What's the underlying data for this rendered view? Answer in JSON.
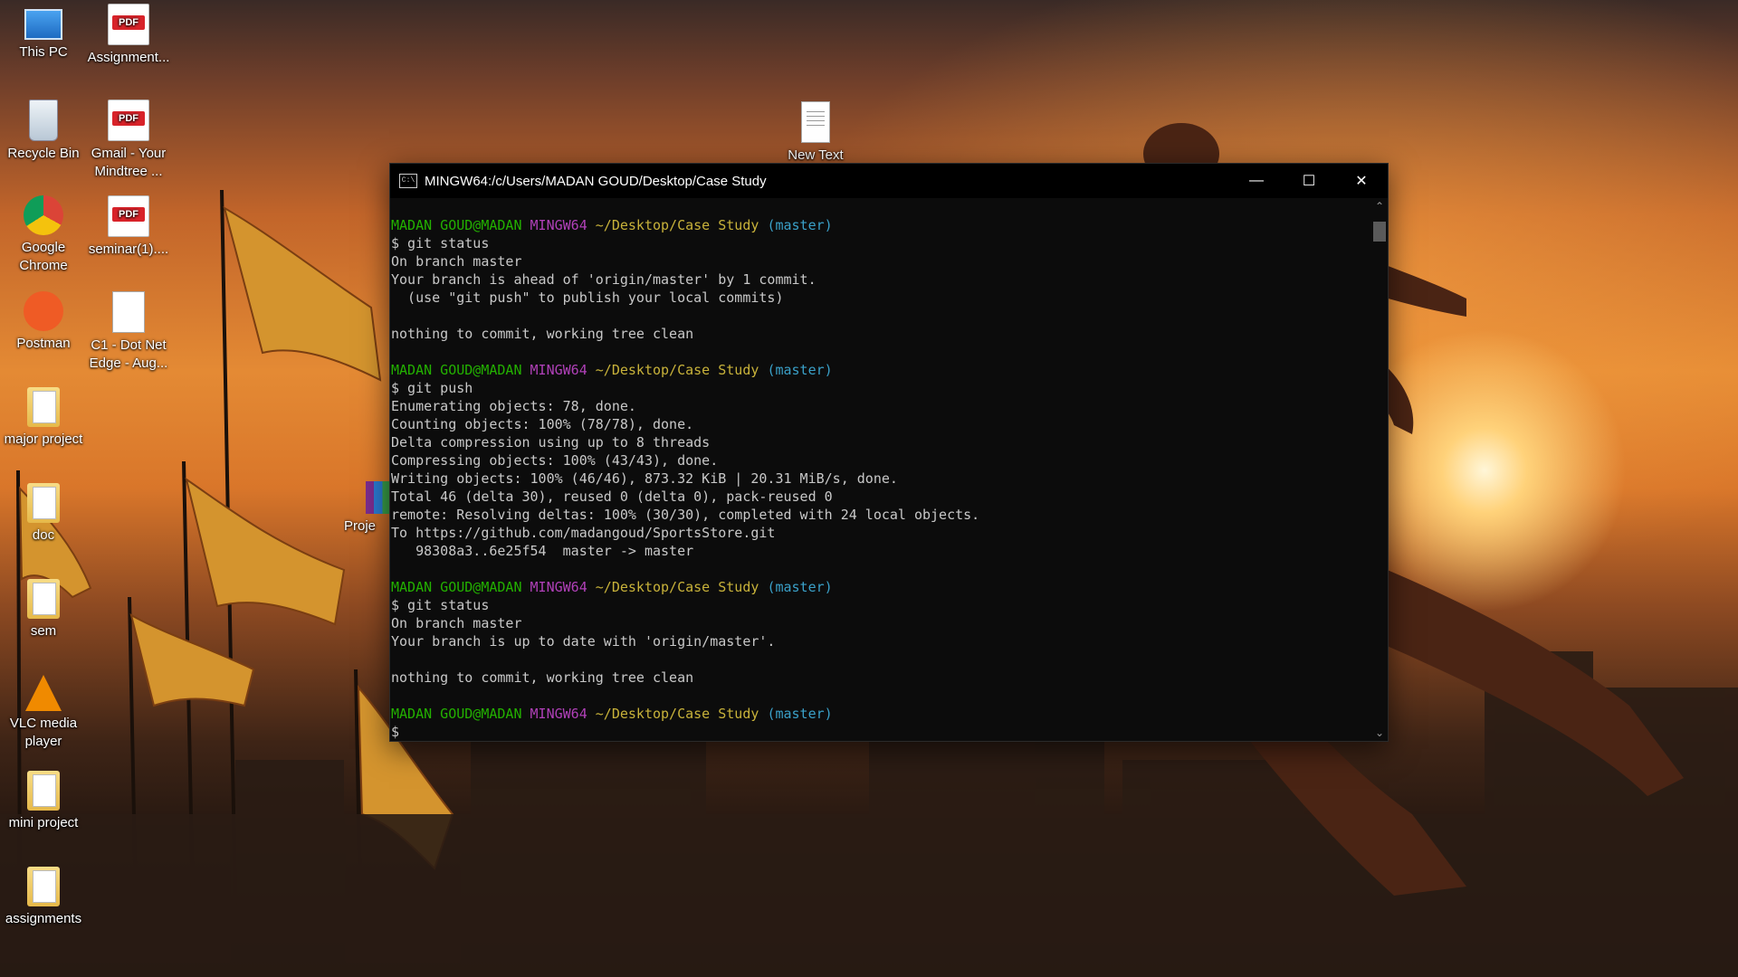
{
  "desktop": {
    "icons_left": [
      {
        "label": "This PC",
        "icon": "computer-icon"
      },
      {
        "label": "Recycle Bin",
        "icon": "recycle-bin-icon"
      },
      {
        "label": "Google Chrome",
        "icon": "chrome-icon"
      },
      {
        "label": "Postman",
        "icon": "postman-icon"
      },
      {
        "label": "major project",
        "icon": "folder-icon"
      },
      {
        "label": "doc",
        "icon": "folder-icon"
      },
      {
        "label": "sem",
        "icon": "folder-icon"
      },
      {
        "label": "VLC media player",
        "icon": "vlc-icon"
      },
      {
        "label": "mini project",
        "icon": "folder-icon"
      },
      {
        "label": "assignments",
        "icon": "folder-icon"
      }
    ],
    "icons_col2": [
      {
        "label": "Assignment...",
        "icon": "pdf-icon"
      },
      {
        "label": "Gmail - Your Mindtree ...",
        "icon": "pdf-icon"
      },
      {
        "label": "seminar(1)....",
        "icon": "pdf-icon"
      },
      {
        "label": "C1 - Dot Net Edge - Aug...",
        "icon": "excel-icon"
      }
    ],
    "partial_icon": {
      "label": "Proje",
      "icon": "winrar-icon"
    },
    "new_text": {
      "label": "New Text",
      "icon": "text-file-icon"
    }
  },
  "window": {
    "title": "MINGW64:/c/Users/MADAN GOUD/Desktop/Case Study",
    "app_icon": "C:\\",
    "minimize": "—",
    "maximize": "☐",
    "close": "✕"
  },
  "terminal": {
    "prompt": {
      "user": "MADAN GOUD@MADAN",
      "env": "MINGW64",
      "path": "~/Desktop/Case Study",
      "branch": "(master)"
    },
    "lines": [
      {
        "t": "prompt"
      },
      {
        "t": "text",
        "v": "$ git status"
      },
      {
        "t": "text",
        "v": "On branch master"
      },
      {
        "t": "text",
        "v": "Your branch is ahead of 'origin/master' by 1 commit."
      },
      {
        "t": "text",
        "v": "  (use \"git push\" to publish your local commits)"
      },
      {
        "t": "text",
        "v": ""
      },
      {
        "t": "text",
        "v": "nothing to commit, working tree clean"
      },
      {
        "t": "text",
        "v": ""
      },
      {
        "t": "prompt"
      },
      {
        "t": "text",
        "v": "$ git push"
      },
      {
        "t": "text",
        "v": "Enumerating objects: 78, done."
      },
      {
        "t": "text",
        "v": "Counting objects: 100% (78/78), done."
      },
      {
        "t": "text",
        "v": "Delta compression using up to 8 threads"
      },
      {
        "t": "text",
        "v": "Compressing objects: 100% (43/43), done."
      },
      {
        "t": "text",
        "v": "Writing objects: 100% (46/46), 873.32 KiB | 20.31 MiB/s, done."
      },
      {
        "t": "text",
        "v": "Total 46 (delta 30), reused 0 (delta 0), pack-reused 0"
      },
      {
        "t": "text",
        "v": "remote: Resolving deltas: 100% (30/30), completed with 24 local objects."
      },
      {
        "t": "text",
        "v": "To https://github.com/madangoud/SportsStore.git"
      },
      {
        "t": "text",
        "v": "   98308a3..6e25f54  master -> master"
      },
      {
        "t": "text",
        "v": ""
      },
      {
        "t": "prompt"
      },
      {
        "t": "text",
        "v": "$ git status"
      },
      {
        "t": "text",
        "v": "On branch master"
      },
      {
        "t": "text",
        "v": "Your branch is up to date with 'origin/master'."
      },
      {
        "t": "text",
        "v": ""
      },
      {
        "t": "text",
        "v": "nothing to commit, working tree clean"
      },
      {
        "t": "text",
        "v": ""
      },
      {
        "t": "prompt"
      },
      {
        "t": "text",
        "v": "$"
      }
    ]
  }
}
